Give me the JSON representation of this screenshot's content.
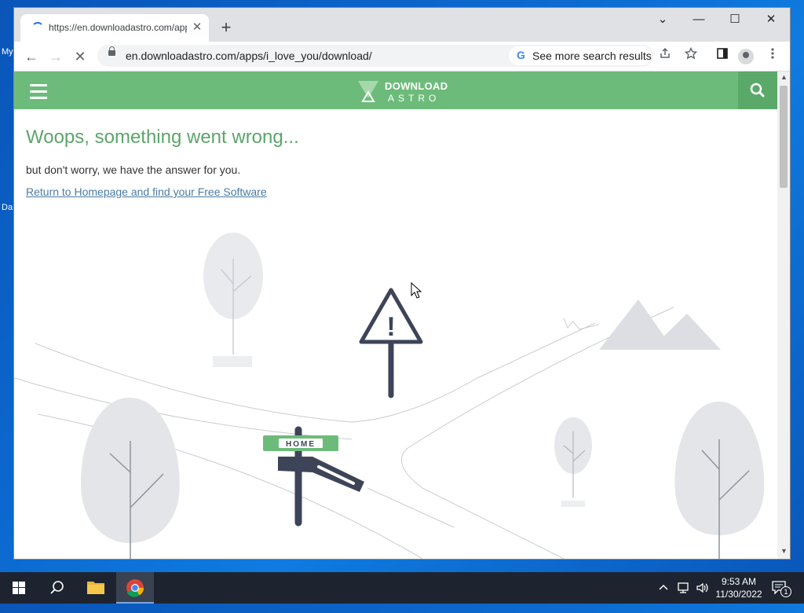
{
  "desktop": {
    "label_top": "My",
    "label_mid": "Da"
  },
  "browser": {
    "tab": {
      "title": "https://en.downloadastro.com/apps/i_love_you/download/",
      "close_glyph": "✕"
    },
    "new_tab_glyph": "+",
    "window_controls": {
      "dropdown": "⌄",
      "minimize": "—",
      "maximize": "☐",
      "close": "✕"
    },
    "nav": {
      "back": "←",
      "forward": "→",
      "reload": "✕"
    },
    "address": {
      "url": "en.downloadastro.com/apps/i_love_you/download/"
    },
    "search_chip": {
      "g": "G",
      "text": "See more search results"
    }
  },
  "site": {
    "brand_colors": {
      "header": "#6dbb7a",
      "accent": "#5ca56a",
      "link": "#4a7ba6"
    },
    "logo": {
      "word1": "DOWNLOAD",
      "word2": "ASTRO"
    },
    "error": {
      "title": "Woops, something went wrong...",
      "subtitle": "but don't worry, we have the answer for you.",
      "link": "Return to Homepage and find your Free Software"
    },
    "illustration": {
      "sign_label": "HOME",
      "warning_mark": "!"
    }
  },
  "taskbar": {
    "clock_time": "9:53 AM",
    "clock_date": "11/30/2022",
    "notification_count": "1"
  }
}
